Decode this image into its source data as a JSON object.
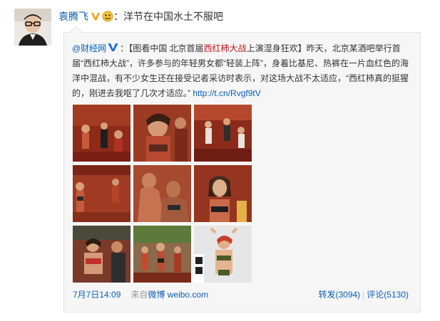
{
  "post": {
    "author": "袁腾飞",
    "text": "洋节在中国水土不服吧"
  },
  "repost": {
    "author": "@财经网",
    "colon": "：",
    "bracket_open": "【图看中国 北京首届",
    "highlight": "西红柿大战",
    "bracket_close": "上演湿身狂欢】",
    "body": "昨天，北京某酒吧举行首届“西红柿大战”，许多参与的年轻男女都“轻装上阵”，身着比基尼、热裤在一片血红色的海洋中混战，有不少女生还在接受记者采访时表示，对这场大战不太适应，“西红柿真的挺猩的，刚进去我呕了几次才适应。”",
    "link": "http://t.cn/Rvgf9tV",
    "time": "7月7日14:09",
    "source_prefix": "来自",
    "source": "微博 weibo.com",
    "repost_label": "转发(3094)",
    "divider": "|",
    "comment_label": "评论(5130)"
  },
  "icons": {
    "verified": "verified-v-icon",
    "emoji": "emoji-face-icon",
    "verified_blue": "verified-blue-v-icon"
  },
  "colors": {
    "link": "#0a5fb5",
    "highlight": "#c1111c",
    "repost_bg": "#f6f6f6"
  },
  "photos": [
    {
      "label": "photo-1"
    },
    {
      "label": "photo-2"
    },
    {
      "label": "photo-3"
    },
    {
      "label": "photo-4"
    },
    {
      "label": "photo-5"
    },
    {
      "label": "photo-6"
    },
    {
      "label": "photo-7"
    },
    {
      "label": "photo-8"
    },
    {
      "label": "photo-9"
    }
  ]
}
